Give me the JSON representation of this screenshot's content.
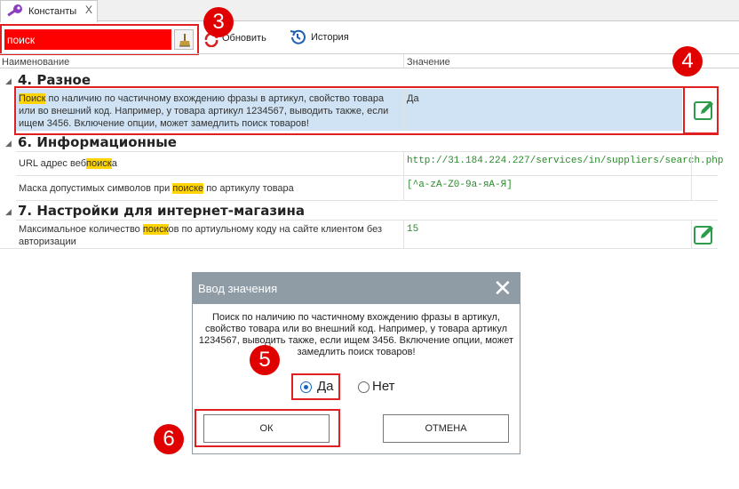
{
  "tab": {
    "label": "Константы",
    "close": "X"
  },
  "toolbar": {
    "search_value": "поиск",
    "refresh_label": "Обновить",
    "history_label": "История"
  },
  "columns": {
    "name": "Наименование",
    "value": "Значение"
  },
  "groups": [
    {
      "title": "4. Разное",
      "rows": [
        {
          "name_hl": "Поиск",
          "name_rest": " по наличию по частичному вхождению фразы в артикул, свойство товара или во внешний код. Например, у товара артикул 1234567, выводить также, если ищем 3456. Включение опции, может замедлить поиск товаров!",
          "value": "Да"
        }
      ]
    },
    {
      "title": "6. Информационные",
      "rows": [
        {
          "name_pre": "URL адрес веб",
          "name_hl": "поиск",
          "name_post": "а",
          "value": "http://31.184.224.227/services/in/suppliers/search.php"
        },
        {
          "name_pre": "Маска допустимых символов при ",
          "name_hl": "поиске",
          "name_post": " по артикулу товара",
          "value": "[^a-zA-Z0-9а-яА-Я]"
        }
      ]
    },
    {
      "title": "7. Настройки для интернет-магазина",
      "rows": [
        {
          "name_pre": "Максимальное количество ",
          "name_hl": "поиск",
          "name_post": "ов по артиульному коду на сайте клиентом без авторизации",
          "value": "15"
        }
      ]
    }
  ],
  "badges": {
    "b3": "3",
    "b4": "4",
    "b5": "5",
    "b6": "6"
  },
  "dialog": {
    "title": "Ввод значения",
    "close": "✕",
    "description": "Поиск по наличию по частичному вхождению фразы в артикул, свойство товара или во внешний код. Например, у товара артикул 1234567, выводить также, если ищем 3456. Включение опции, может замедлить поиск товаров!",
    "option_yes": "Да",
    "option_no": "Нет",
    "selected": "Да",
    "ok_label": "ОК",
    "cancel_label": "ОТМЕНА"
  },
  "colors": {
    "highlight": "#ffd400",
    "selected_row": "#cfe3f4",
    "annotation": "#e00000",
    "dialog_title": "#8f9ca6",
    "value_green": "#2b8a2b"
  },
  "icons": [
    "key-icon",
    "broom-icon",
    "refresh-icon",
    "history-icon",
    "edit-icon",
    "close-icon"
  ]
}
